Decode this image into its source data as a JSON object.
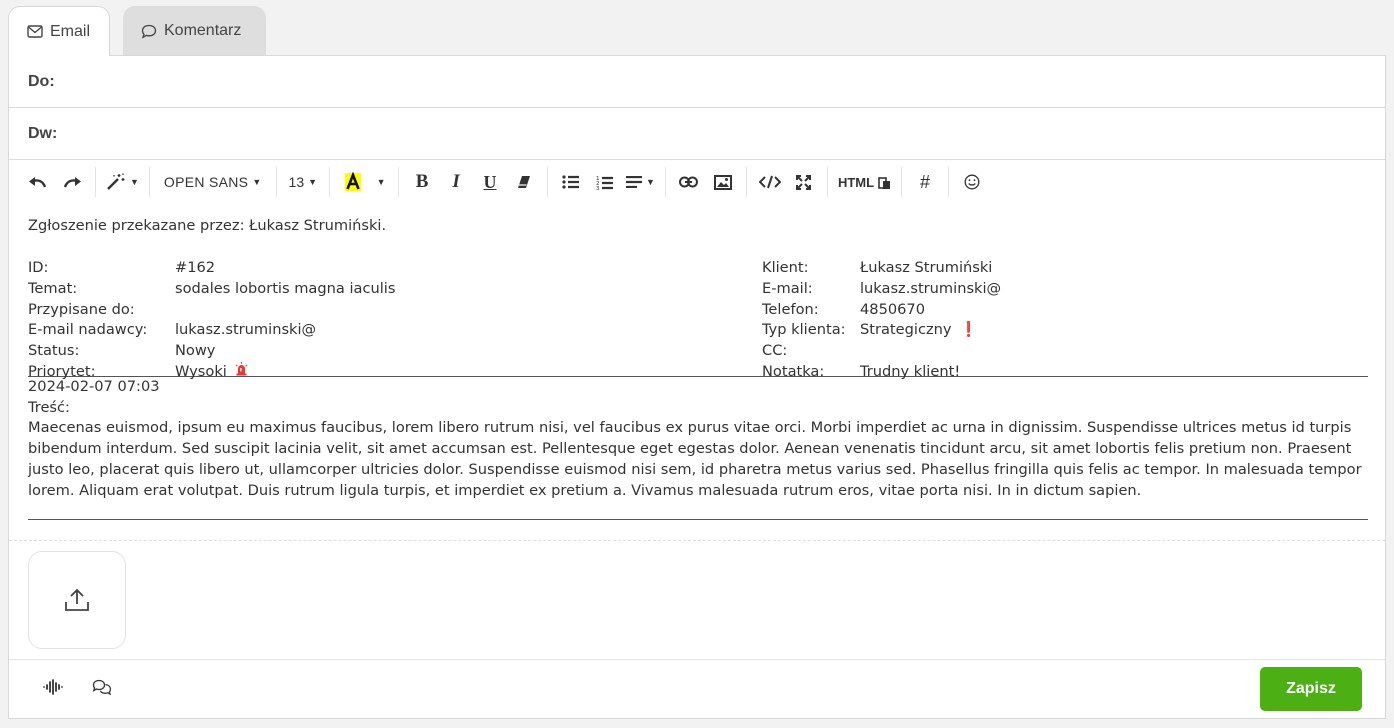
{
  "tabs": [
    {
      "label": "Email",
      "icon": "mail-icon",
      "active": true
    },
    {
      "label": "Komentarz",
      "icon": "comment-icon",
      "active": false
    }
  ],
  "fields": {
    "to_label": "Do:",
    "cc_label": "Dw:"
  },
  "toolbar": {
    "font": "OPEN SANS",
    "size": "13",
    "html": "HTML"
  },
  "message": {
    "intro": "Zgłoszenie przekazane przez: Łukasz Strumiński.",
    "left": [
      {
        "label": "ID:",
        "value": "#162"
      },
      {
        "label": "Temat:",
        "value": "sodales lobortis magna iaculis"
      },
      {
        "label": "Przypisane do:",
        "value": ""
      },
      {
        "label": "E-mail nadawcy:",
        "value": "lukasz.struminski@"
      },
      {
        "label": "Status:",
        "value": "Nowy"
      },
      {
        "label": "Priorytet:",
        "value": "Wysoki"
      }
    ],
    "right": [
      {
        "label": "Klient:",
        "value": "Łukasz Strumiński"
      },
      {
        "label": "E-mail:",
        "value": "lukasz.struminski@"
      },
      {
        "label": "Telefon:",
        "value": "4850670"
      },
      {
        "label": "Typ klienta:",
        "value": "Strategiczny"
      },
      {
        "label": "CC:",
        "value": ""
      },
      {
        "label": "Notatka:",
        "value": "Trudny klient!"
      }
    ],
    "priority_mark": "❗",
    "date": "2024-02-07 07:03",
    "body_label": "Treść:",
    "body": "Maecenas euismod, ipsum eu maximus faucibus, lorem libero rutrum nisi, vel faucibus ex purus vitae orci. Morbi imperdiet ac urna in dignissim. Suspendisse ultrices metus id turpis bibendum interdum. Sed suscipit lacinia velit, sit amet accumsan est. Pellentesque eget egestas dolor. Aenean venenatis tincidunt arcu, sit amet lobortis felis pretium non. Praesent justo leo, placerat quis libero ut, ullamcorper ultricies dolor. Suspendisse euismod nisi sem, id pharetra metus varius sed. Phasellus fringilla quis felis ac tempor. In malesuada tempor lorem. Aliquam erat volutpat. Duis rutrum ligula turpis, et imperdiet ex pretium a. Vivamus malesuada rutrum eros, vitae porta nisi. In in dictum sapien."
  },
  "footer": {
    "save_label": "Zapisz"
  },
  "colors": {
    "save_button": "#4caf13",
    "highlight_yellow": "#ffff00",
    "alert_red": "#d0021b"
  }
}
